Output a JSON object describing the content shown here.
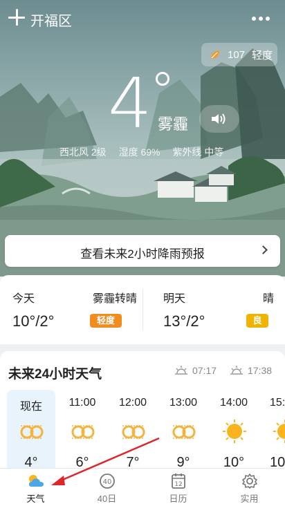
{
  "header": {
    "city": "开福区"
  },
  "aqi": {
    "value": "107",
    "level": "轻度"
  },
  "current": {
    "temp": "4",
    "condition": "雾霾",
    "wind": "西北风 2级",
    "humidity": "湿度 69%",
    "uv_label": "紫外线",
    "uv_value": "中等"
  },
  "rain_forecast": {
    "label": "查看未来2小时降雨预报"
  },
  "daily": [
    {
      "day": "今天",
      "condition": "雾霾转晴",
      "temp": "10°/2°",
      "aq": "轻度",
      "aq_color": "#f18c1e"
    },
    {
      "day": "明天",
      "condition": "晴",
      "temp": "13°/2°",
      "aq": "良",
      "aq_color": "#f0b400"
    }
  ],
  "hourly": {
    "title": "未来24小时天气",
    "sunrise": "07:17",
    "sunset": "17:38",
    "items": [
      {
        "time": "现在",
        "icon": "haze-icon",
        "temp": "4°"
      },
      {
        "time": "11:00",
        "icon": "haze-icon",
        "temp": "6°"
      },
      {
        "time": "12:00",
        "icon": "haze-icon",
        "temp": "7°"
      },
      {
        "time": "13:00",
        "icon": "haze-icon",
        "temp": "9°"
      },
      {
        "time": "14:00",
        "icon": "sun-icon",
        "temp": "10°"
      },
      {
        "time": "15:",
        "icon": "sun-icon",
        "temp": "10"
      }
    ]
  },
  "tabs": [
    {
      "label": "天气",
      "icon": "weather-icon",
      "active": true
    },
    {
      "label": "40日",
      "icon": "forty-day-icon",
      "active": false
    },
    {
      "label": "日历",
      "icon": "calendar-icon",
      "active": false
    },
    {
      "label": "实用",
      "icon": "gear-icon",
      "active": false
    }
  ],
  "calendar_day": "12",
  "forty_badge": "40",
  "colors": {
    "accent_arrow": "#e0252b",
    "haze_icon": "#f3b33d",
    "sun_icon": "#fbb31f"
  }
}
